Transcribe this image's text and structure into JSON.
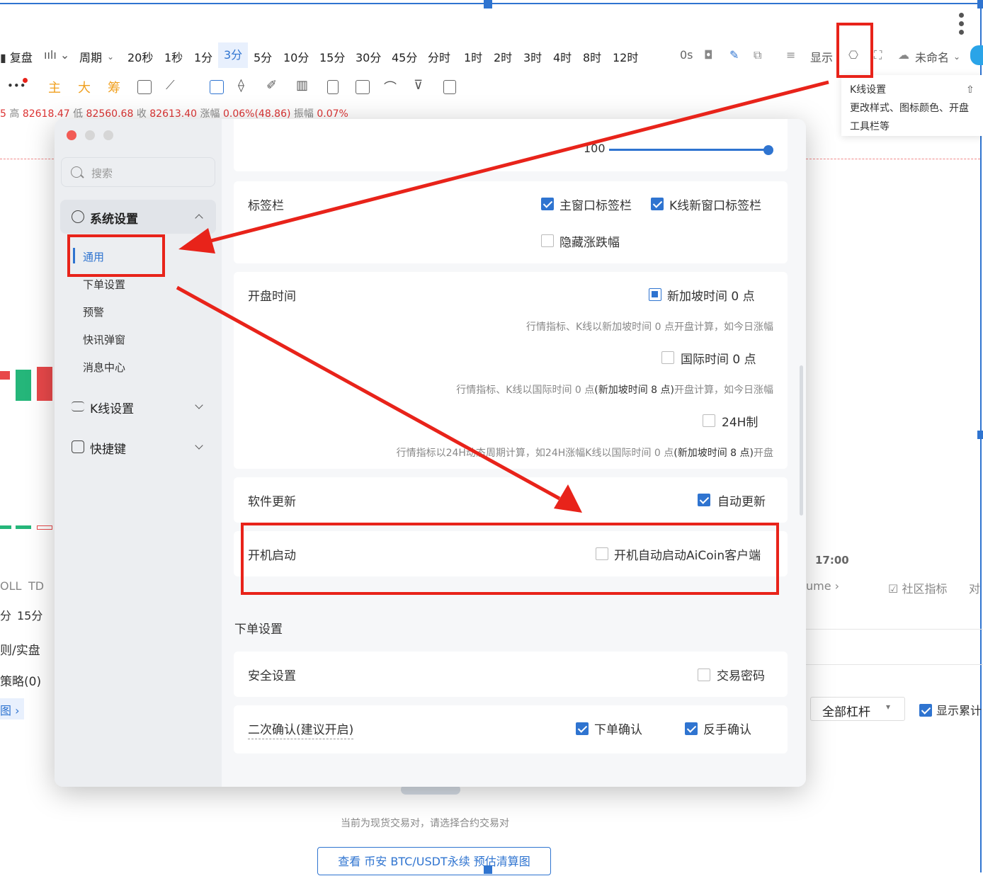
{
  "toolbar": {
    "replay": "复盘",
    "period_label": "周期",
    "periods": [
      "20秒",
      "1秒",
      "1分",
      "3分",
      "5分",
      "10分",
      "15分",
      "30分",
      "45分",
      "分时",
      "1时",
      "2时",
      "3时",
      "4时",
      "8时",
      "12时"
    ],
    "active_period": "3分",
    "latency": "0s",
    "display": "显示",
    "unnamed": "未命名",
    "indicator_tabs": [
      "主",
      "大",
      "筹"
    ],
    "ellipsis": "•••"
  },
  "price_bar": {
    "prefix": "5",
    "high_label": "高",
    "high": "82618.47",
    "low_label": "低",
    "low": "82560.68",
    "close_label": "收",
    "close": "82613.40",
    "change_label": "涨幅",
    "change": "0.06%(48.86)",
    "amplitude_label": "振幅",
    "amplitude": "0.07%"
  },
  "tooltip": {
    "title": "K线设置",
    "line1": "更改样式、图标颜色、开盘",
    "line2": "工具栏等"
  },
  "background": {
    "time_label": "17:00",
    "oll": "OLL",
    "td": "TD",
    "interval_prefix": "分",
    "interval": "15分",
    "real_trade": "则/实盘",
    "strategy": "策略(0)",
    "chart_link": "图",
    "volume": "ume",
    "community": "社区指标",
    "compare": "对",
    "leverage": "全部杠杆",
    "show_cumulative": "显示累计",
    "spot_notice": "当前为现货交易对，请选择合约交易对",
    "view_button": "查看 币安 BTC/USDT永续 预估清算图"
  },
  "dialog": {
    "search_placeholder": "搜索",
    "sidebar": {
      "system_settings": "系统设置",
      "sub_items": [
        "通用",
        "下单设置",
        "预警",
        "快讯弹窗",
        "消息中心"
      ],
      "kline_settings": "K线设置",
      "shortcuts": "快捷键"
    },
    "slider_value": "100",
    "tab_bar": {
      "title": "标签栏",
      "main_window_tab": "主窗口标签栏",
      "kline_new_window_tab": "K线新窗口标签栏",
      "hide_change": "隐藏涨跌幅"
    },
    "open_time": {
      "title": "开盘时间",
      "singapore": "新加坡时间 0 点",
      "singapore_desc": "行情指标、K线以新加坡时间 0 点开盘计算，如今日涨幅",
      "international": "国际时间 0 点",
      "international_desc_a": "行情指标、K线以国际时间 0 点",
      "international_desc_b": "(新加坡时间 8 点)",
      "international_desc_c": "开盘计算，如今日涨幅",
      "h24": "24H制",
      "h24_desc_a": "行情指标以24H动态周期计算，如24H涨幅K线以国际时间 0 点",
      "h24_desc_b": "(新加坡时间 8 点)",
      "h24_desc_c": "开盘"
    },
    "software_update": {
      "title": "软件更新",
      "auto_update": "自动更新"
    },
    "startup": {
      "title": "开机启动",
      "auto_start": "开机自动启动AiCoin客户端"
    },
    "order_settings_heading": "下单设置",
    "security": {
      "title": "安全设置",
      "trade_password": "交易密码"
    },
    "confirm": {
      "title": "二次确认(建议开启)",
      "order_confirm": "下单确认",
      "reverse_confirm": "反手确认"
    }
  },
  "colors": {
    "accent": "#2f74d0",
    "annotation_red": "#e8231a",
    "up": "#d33",
    "candle_green": "#25b67a",
    "candle_red": "#e8484a",
    "indicator_orange": "#f0a020"
  }
}
